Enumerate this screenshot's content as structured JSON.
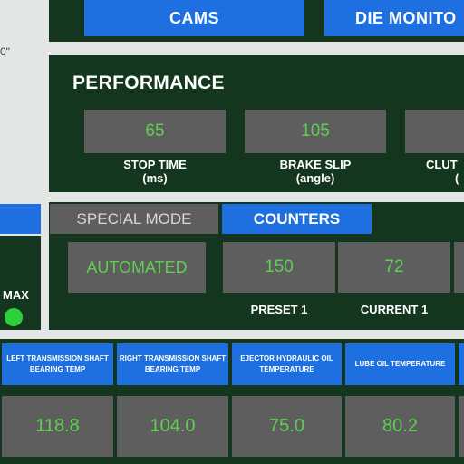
{
  "nav": {
    "cams_label": "CAMS",
    "die_monitor_label": "DIE MONITO"
  },
  "left_fragment": {
    "quote_text": "0\"",
    "max_label": "MAX",
    "indicator_color": "#2fd13a"
  },
  "performance": {
    "title": "PERFORMANCE",
    "metrics": [
      {
        "value": "65",
        "label": "STOP TIME",
        "unit": "(ms)"
      },
      {
        "value": "105",
        "label": "BRAKE SLIP",
        "unit": "(angle)"
      },
      {
        "value": "",
        "label": "CLUT",
        "unit": "("
      }
    ]
  },
  "mode_tabs": {
    "special_mode_label": "SPECIAL MODE",
    "counters_label": "COUNTERS"
  },
  "mode": {
    "value": "AUTOMATED"
  },
  "counters": [
    {
      "value": "150",
      "label": "PRESET 1"
    },
    {
      "value": "72",
      "label": "CURRENT 1"
    }
  ],
  "temperatures": [
    {
      "header": "LEFT TRANSMISSION SHAFT BEARING TEMP",
      "value": "118.8"
    },
    {
      "header": "RIGHT TRANSMISSION SHAFT BEARING TEMP",
      "value": "104.0"
    },
    {
      "header": "EJECTOR HYDRAULIC OIL TEMPERATURE",
      "value": "75.0"
    },
    {
      "header": "LUBE OIL TEMPERATURE",
      "value": "80.2"
    }
  ],
  "colors": {
    "panel": "#15361e",
    "accent_blue": "#1e6fe0",
    "value_green": "#5fcf52",
    "box_gray": "#5e5e5e"
  }
}
